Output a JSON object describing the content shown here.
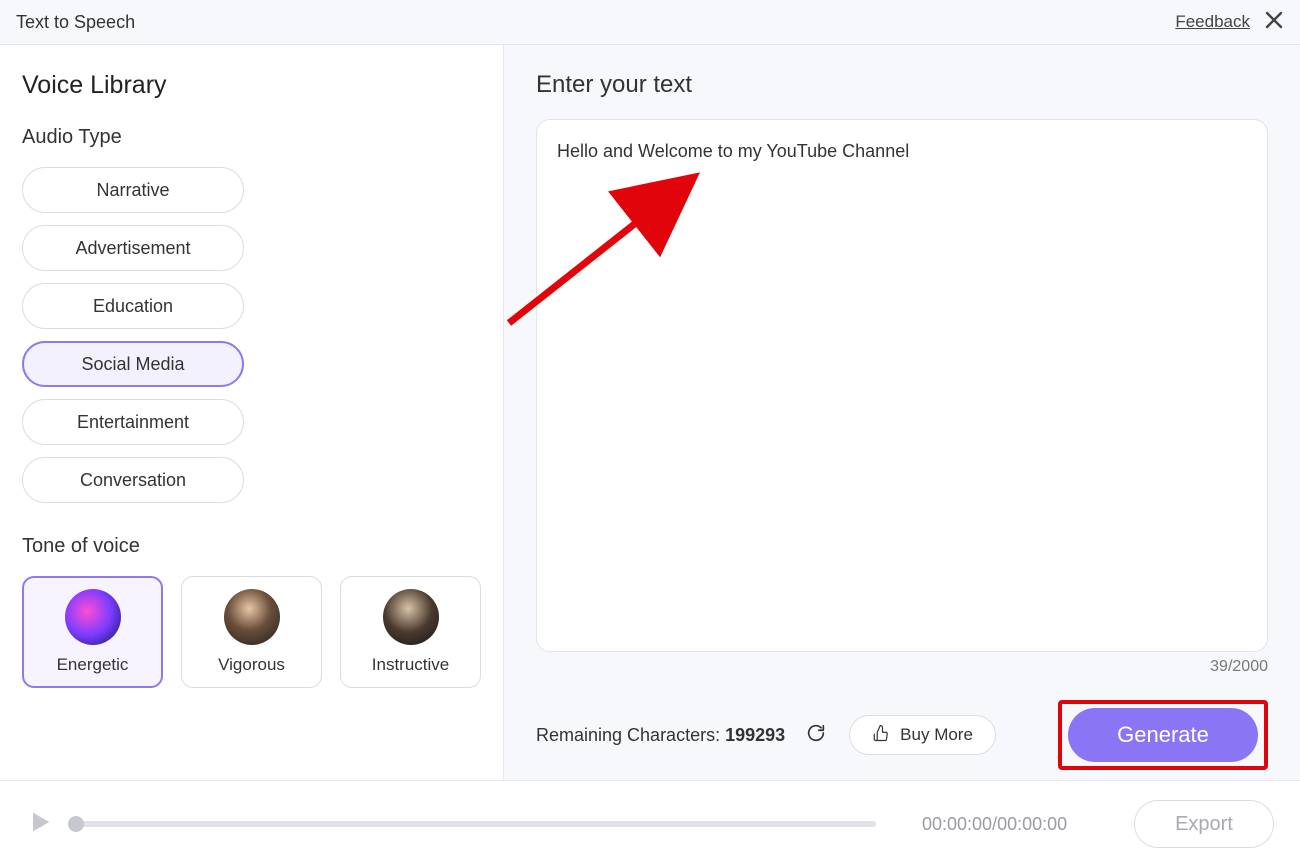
{
  "titlebar": {
    "title": "Text to Speech",
    "feedback": "Feedback"
  },
  "sidebar": {
    "heading": "Voice Library",
    "audio_type": {
      "label": "Audio Type",
      "options": [
        "Narrative",
        "Advertisement",
        "Education",
        "Social Media",
        "Entertainment",
        "Conversation"
      ],
      "selected_index": 3
    },
    "tone": {
      "label": "Tone of voice",
      "options": [
        "Energetic",
        "Vigorous",
        "Instructive"
      ],
      "selected_index": 0
    }
  },
  "content": {
    "heading": "Enter your text",
    "text_value": "Hello and Welcome to my YouTube Channel",
    "counter": "39/2000",
    "remaining_label": "Remaining Characters:",
    "remaining_value": "199293",
    "buy_more": "Buy More",
    "generate": "Generate"
  },
  "player": {
    "time": "00:00:00/00:00:00",
    "export": "Export"
  },
  "colors": {
    "accent": "#8a75f5",
    "highlight_box": "#e2040b",
    "arrow": "#e2040b"
  }
}
